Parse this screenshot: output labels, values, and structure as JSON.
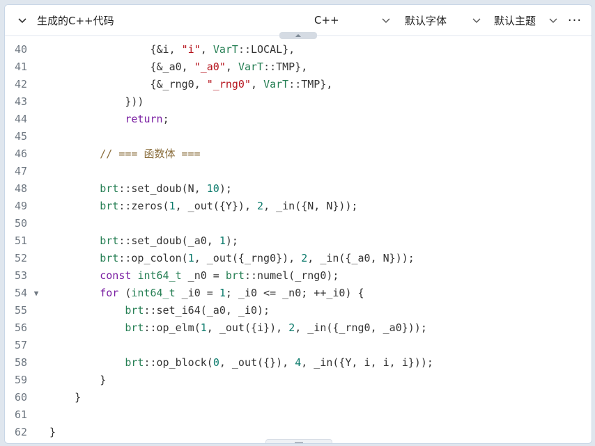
{
  "header": {
    "title": "生成的C++代码",
    "language": "C++",
    "font": "默认字体",
    "theme": "默认主题",
    "more": "···"
  },
  "colors": {
    "keyword": "#7a1fa2",
    "type": "#267f54",
    "string": "#b5121b",
    "number": "#0b7a6b",
    "comment": "#8a6d3b",
    "line_number": "#6e7781"
  },
  "code": {
    "lines": [
      {
        "n": "40",
        "fold": "",
        "tokens": [
          [
            "t-text",
            "                {&i, "
          ],
          [
            "t-str",
            "\"i\""
          ],
          [
            "t-text",
            ", "
          ],
          [
            "t-ns",
            "VarT"
          ],
          [
            "t-op",
            "::"
          ],
          [
            "t-text",
            "LOCAL},"
          ]
        ]
      },
      {
        "n": "41",
        "fold": "",
        "tokens": [
          [
            "t-text",
            "                {&_a0, "
          ],
          [
            "t-str",
            "\"_a0\""
          ],
          [
            "t-text",
            ", "
          ],
          [
            "t-ns",
            "VarT"
          ],
          [
            "t-op",
            "::"
          ],
          [
            "t-text",
            "TMP},"
          ]
        ]
      },
      {
        "n": "42",
        "fold": "",
        "tokens": [
          [
            "t-text",
            "                {&_rng0, "
          ],
          [
            "t-str",
            "\"_rng0\""
          ],
          [
            "t-text",
            ", "
          ],
          [
            "t-ns",
            "VarT"
          ],
          [
            "t-op",
            "::"
          ],
          [
            "t-text",
            "TMP},"
          ]
        ]
      },
      {
        "n": "43",
        "fold": "",
        "tokens": [
          [
            "t-text",
            "            }))"
          ]
        ]
      },
      {
        "n": "44",
        "fold": "",
        "tokens": [
          [
            "t-text",
            "            "
          ],
          [
            "t-kw",
            "return"
          ],
          [
            "t-text",
            ";"
          ]
        ]
      },
      {
        "n": "45",
        "fold": "",
        "tokens": []
      },
      {
        "n": "46",
        "fold": "",
        "tokens": [
          [
            "t-cm",
            "        // === 函数体 ==="
          ]
        ]
      },
      {
        "n": "47",
        "fold": "",
        "tokens": []
      },
      {
        "n": "48",
        "fold": "",
        "tokens": [
          [
            "t-text",
            "        "
          ],
          [
            "t-ns",
            "brt"
          ],
          [
            "t-op",
            "::"
          ],
          [
            "t-text",
            "set_doub(N, "
          ],
          [
            "t-num",
            "10"
          ],
          [
            "t-text",
            ");"
          ]
        ]
      },
      {
        "n": "49",
        "fold": "",
        "tokens": [
          [
            "t-text",
            "        "
          ],
          [
            "t-ns",
            "brt"
          ],
          [
            "t-op",
            "::"
          ],
          [
            "t-text",
            "zeros("
          ],
          [
            "t-num",
            "1"
          ],
          [
            "t-text",
            ", _out({Y}), "
          ],
          [
            "t-num",
            "2"
          ],
          [
            "t-text",
            ", _in({N, N}));"
          ]
        ]
      },
      {
        "n": "50",
        "fold": "",
        "tokens": []
      },
      {
        "n": "51",
        "fold": "",
        "tokens": [
          [
            "t-text",
            "        "
          ],
          [
            "t-ns",
            "brt"
          ],
          [
            "t-op",
            "::"
          ],
          [
            "t-text",
            "set_doub(_a0, "
          ],
          [
            "t-num",
            "1"
          ],
          [
            "t-text",
            ");"
          ]
        ]
      },
      {
        "n": "52",
        "fold": "",
        "tokens": [
          [
            "t-text",
            "        "
          ],
          [
            "t-ns",
            "brt"
          ],
          [
            "t-op",
            "::"
          ],
          [
            "t-text",
            "op_colon("
          ],
          [
            "t-num",
            "1"
          ],
          [
            "t-text",
            ", _out({_rng0}), "
          ],
          [
            "t-num",
            "2"
          ],
          [
            "t-text",
            ", _in({_a0, N}));"
          ]
        ]
      },
      {
        "n": "53",
        "fold": "",
        "tokens": [
          [
            "t-text",
            "        "
          ],
          [
            "t-kw",
            "const"
          ],
          [
            "t-text",
            " "
          ],
          [
            "t-ty",
            "int64_t"
          ],
          [
            "t-text",
            " _n0 = "
          ],
          [
            "t-ns",
            "brt"
          ],
          [
            "t-op",
            "::"
          ],
          [
            "t-text",
            "numel(_rng0);"
          ]
        ]
      },
      {
        "n": "54",
        "fold": "▼",
        "tokens": [
          [
            "t-text",
            "        "
          ],
          [
            "t-kw",
            "for"
          ],
          [
            "t-text",
            " ("
          ],
          [
            "t-ty",
            "int64_t"
          ],
          [
            "t-text",
            " _i0 = "
          ],
          [
            "t-num",
            "1"
          ],
          [
            "t-text",
            "; _i0 <= _n0; ++_i0) {"
          ]
        ]
      },
      {
        "n": "55",
        "fold": "",
        "tokens": [
          [
            "t-text",
            "            "
          ],
          [
            "t-ns",
            "brt"
          ],
          [
            "t-op",
            "::"
          ],
          [
            "t-text",
            "set_i64(_a0, _i0);"
          ]
        ]
      },
      {
        "n": "56",
        "fold": "",
        "tokens": [
          [
            "t-text",
            "            "
          ],
          [
            "t-ns",
            "brt"
          ],
          [
            "t-op",
            "::"
          ],
          [
            "t-text",
            "op_elm("
          ],
          [
            "t-num",
            "1"
          ],
          [
            "t-text",
            ", _out({i}), "
          ],
          [
            "t-num",
            "2"
          ],
          [
            "t-text",
            ", _in({_rng0, _a0}));"
          ]
        ]
      },
      {
        "n": "57",
        "fold": "",
        "tokens": []
      },
      {
        "n": "58",
        "fold": "",
        "tokens": [
          [
            "t-text",
            "            "
          ],
          [
            "t-ns",
            "brt"
          ],
          [
            "t-op",
            "::"
          ],
          [
            "t-text",
            "op_block("
          ],
          [
            "t-num",
            "0"
          ],
          [
            "t-text",
            ", _out({}), "
          ],
          [
            "t-num",
            "4"
          ],
          [
            "t-text",
            ", _in({Y, i, i, i}));"
          ]
        ]
      },
      {
        "n": "59",
        "fold": "",
        "tokens": [
          [
            "t-text",
            "        }"
          ]
        ]
      },
      {
        "n": "60",
        "fold": "",
        "tokens": [
          [
            "t-text",
            "    }"
          ]
        ]
      },
      {
        "n": "61",
        "fold": "",
        "tokens": []
      },
      {
        "n": "62",
        "fold": "",
        "tokens": [
          [
            "t-text",
            "}"
          ]
        ]
      }
    ]
  }
}
